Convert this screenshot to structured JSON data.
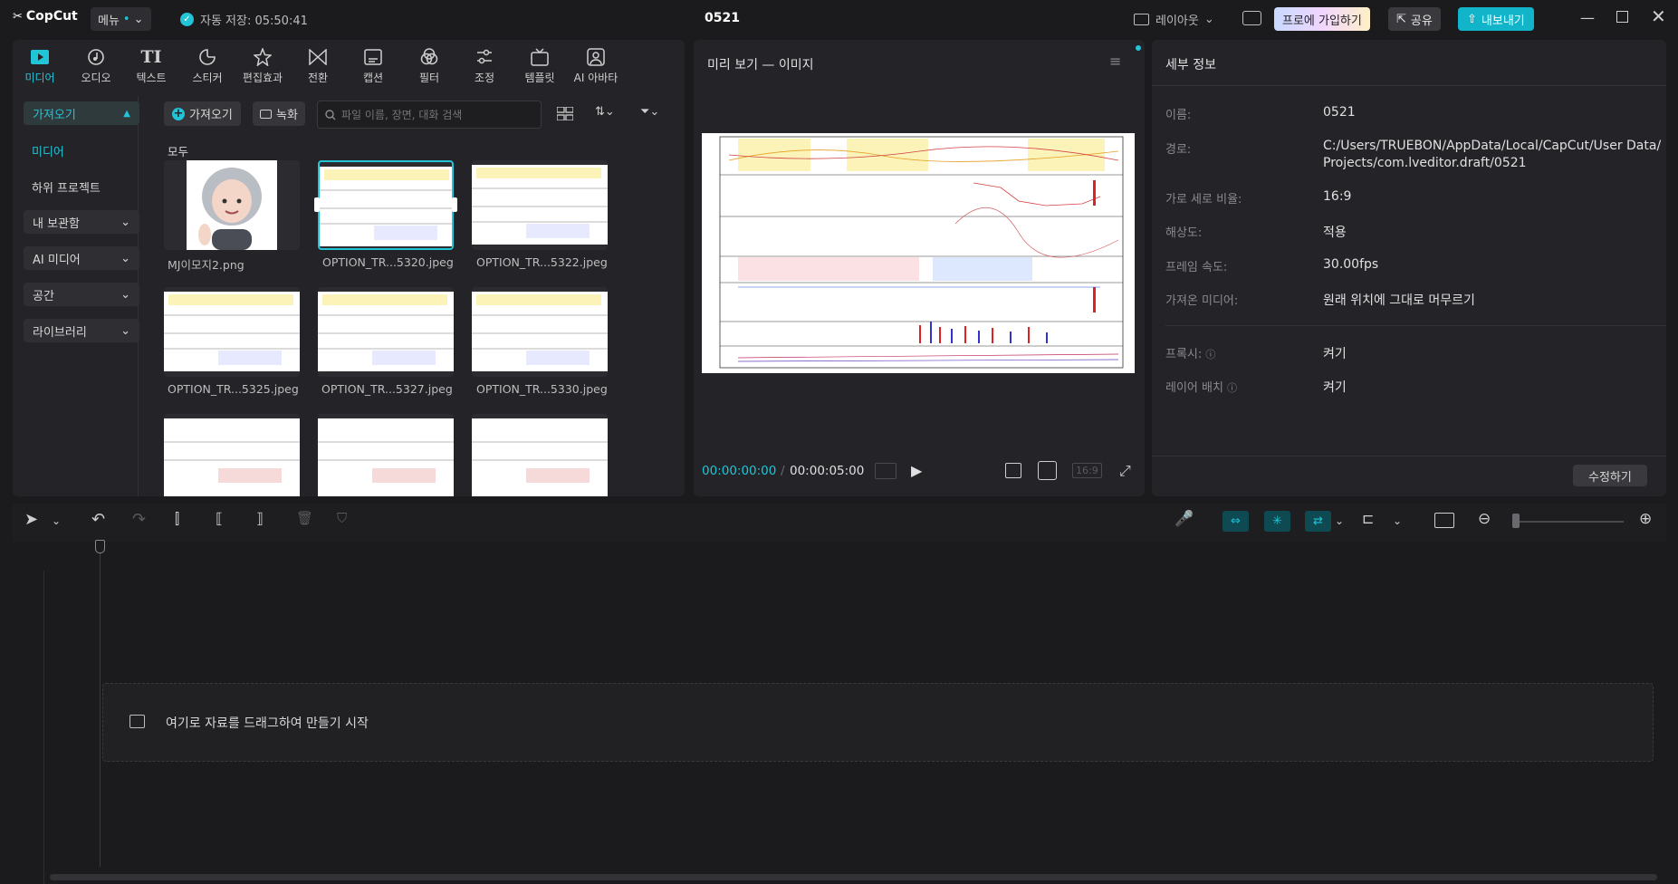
{
  "app": {
    "logo": "CopCut",
    "menu_label": "메뉴",
    "autosave": "자동 저장: 05:50:41",
    "project_title": "0521"
  },
  "titlebar": {
    "layout_label": "레이아웃",
    "pro_label": "프로에 가입하기",
    "share_label": "공유",
    "export_label": "내보내기"
  },
  "toolbar": {
    "tabs": [
      "미디어",
      "오디오",
      "텍스트",
      "스티커",
      "편집효과",
      "전환",
      "캡션",
      "필터",
      "조정",
      "템플릿",
      "AI 아바타"
    ]
  },
  "sidebar": {
    "import_label": "가져오기",
    "media_label": "미디어",
    "subproject_label": "하위 프로젝트",
    "my_storage_label": "내 보관함",
    "ai_media_label": "AI 미디어",
    "space_label": "공간",
    "library_label": "라이브러리"
  },
  "media": {
    "import_button": "가져오기",
    "record_button": "녹화",
    "search_placeholder": "파일 이름, 장면, 대화 검색",
    "section_label": "모두",
    "files": [
      "MJ이모지2.png",
      "OPTION_TR...5320.jpeg",
      "OPTION_TR...5322.jpeg",
      "OPTION_TR...5325.jpeg",
      "OPTION_TR...5327.jpeg",
      "OPTION_TR...5330.jpeg"
    ]
  },
  "preview": {
    "title": "미리 보기 — 이미지",
    "current_time": "00:00:00:00",
    "total_time": "00:00:05:00",
    "ratio": "16:9"
  },
  "details": {
    "title": "세부 정보",
    "name_key": "이름:",
    "name_val": "0521",
    "path_key": "경로:",
    "path_val_1": "C:/Users/TRUEBON/AppData/Local/CapCut/User Data/",
    "path_val_2": "Projects/com.lveditor.draft/0521",
    "ratio_key": "가로 세로 비율:",
    "ratio_val": "16:9",
    "res_key": "해상도:",
    "res_val": "적용",
    "fps_key": "프레임 속도:",
    "fps_val": "30.00fps",
    "imported_key": "가져온 미디어:",
    "imported_val": "원래 위치에 그대로 머무르기",
    "proxy_key": "프록시:",
    "proxy_val": "켜기",
    "layer_key": "레이어 배치",
    "layer_val": "켜기",
    "edit_button": "수정하기"
  },
  "timeline": {
    "drop_hint": "여기로 자료를 드래그하여 만들기 시작"
  },
  "colors": {
    "accent": "#22c4d8",
    "export_bg": "#11b4c9",
    "bg": "#1b1b1d",
    "panel": "#242428"
  }
}
